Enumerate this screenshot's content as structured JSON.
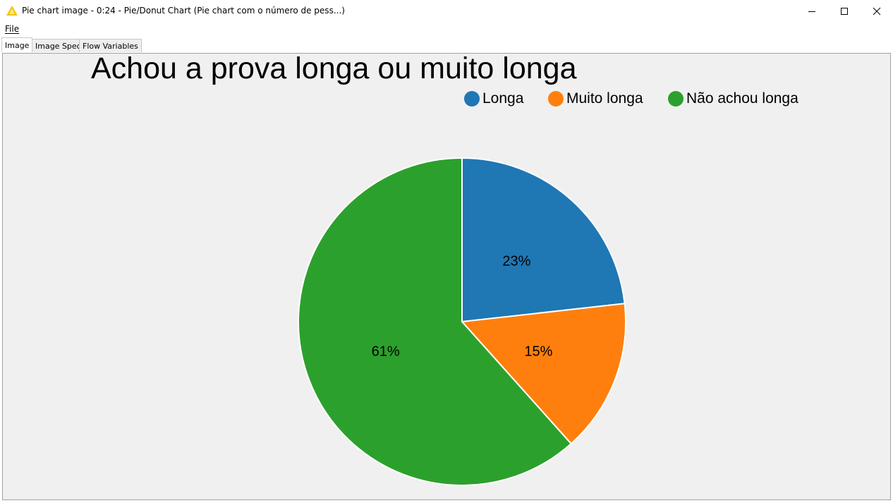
{
  "window": {
    "title": "Pie chart image - 0:24 - Pie/Donut Chart (Pie chart com o número de pess...)",
    "icon": "knime-warning-triangle-icon",
    "controls": [
      "minimize-icon",
      "maximize-icon",
      "close-icon"
    ]
  },
  "menu": {
    "file_label": "File"
  },
  "tabs": [
    {
      "label": "Image",
      "active": true
    },
    {
      "label": "Image Spec",
      "active": false
    },
    {
      "label": "Flow Variables",
      "active": false
    }
  ],
  "chart_data": {
    "type": "pie",
    "title": "Achou a prova longa ou muito longa",
    "legend_position": "top-right",
    "categories": [
      "Longa",
      "Muito longa",
      "Não achou longa"
    ],
    "values": [
      23,
      15,
      61
    ],
    "labels": [
      "23%",
      "15%",
      "61%"
    ],
    "colors": [
      "#1f77b4",
      "#ff7f0e",
      "#2ca02c"
    ]
  }
}
